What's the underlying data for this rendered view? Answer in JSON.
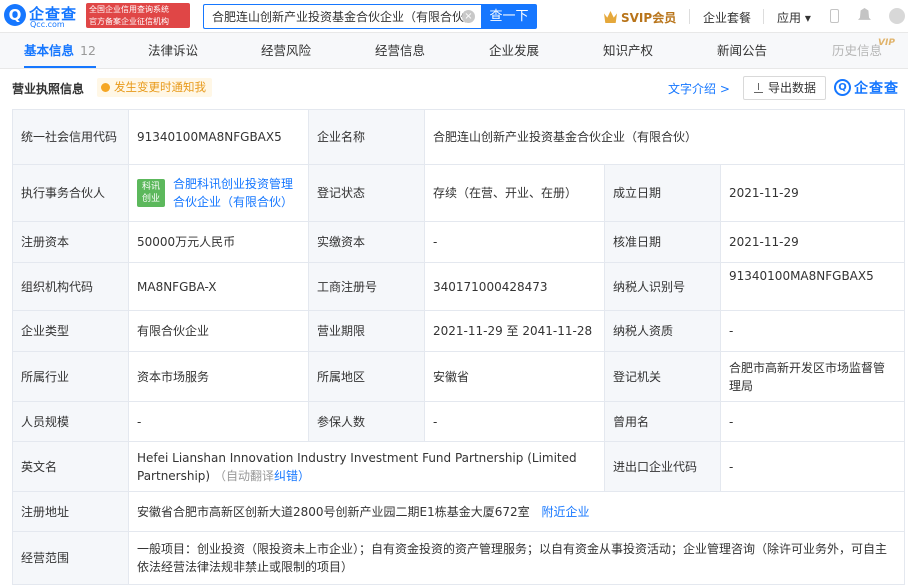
{
  "header": {
    "logo_cn": "企查查",
    "logo_en": "Qcc.com",
    "badge_line1": "全国企业信用查询系统",
    "badge_line2": "官方备案企业征信机构",
    "search_value": "合肥连山创新产业投资基金合伙企业（有限合伙）",
    "search_button": "查一下",
    "svip": "SVIP会员",
    "nav_package": "企业套餐",
    "nav_apps": "应用 ▾"
  },
  "tabs": [
    {
      "label": "基本信息",
      "count": "12"
    },
    {
      "label": "法律诉讼"
    },
    {
      "label": "经营风险"
    },
    {
      "label": "经营信息"
    },
    {
      "label": "企业发展"
    },
    {
      "label": "知识产权"
    },
    {
      "label": "新闻公告"
    },
    {
      "label": "历史信息",
      "tag": "VIP"
    }
  ],
  "section": {
    "title": "营业执照信息",
    "notify": "发生变更时通知我",
    "text_intro": "文字介绍 >",
    "export": "导出数据",
    "watermark": "企查查"
  },
  "table": {
    "credit_code_label": "统一社会信用代码",
    "credit_code": "91340100MA8NFGBAX5",
    "company_name_label": "企业名称",
    "company_name": "合肥连山创新产业投资基金合伙企业（有限合伙）",
    "partner_label": "执行事务合伙人",
    "partner_logo": "科讯 创业",
    "partner_name": "合肥科讯创业投资管理合伙企业（有限合伙）",
    "status_label": "登记状态",
    "status": "存续（在营、开业、在册）",
    "established_label": "成立日期",
    "established": "2021-11-29",
    "reg_capital_label": "注册资本",
    "reg_capital": "50000万元人民币",
    "paid_capital_label": "实缴资本",
    "paid_capital": "-",
    "approval_date_label": "核准日期",
    "approval_date": "2021-11-29",
    "org_code_label": "组织机构代码",
    "org_code": "MA8NFGBA-X",
    "reg_no_label": "工商注册号",
    "reg_no": "340171000428473",
    "taxpayer_id_label": "纳税人识别号",
    "taxpayer_id": "91340100MA8NFGBAX5",
    "company_type_label": "企业类型",
    "company_type": "有限合伙企业",
    "term_label": "营业期限",
    "term": "2021-11-29 至 2041-11-28",
    "taxpayer_qual_label": "纳税人资质",
    "taxpayer_qual": "-",
    "industry_label": "所属行业",
    "industry": "资本市场服务",
    "region_label": "所属地区",
    "region": "安徽省",
    "authority_label": "登记机关",
    "authority": "合肥市高新开发区市场监督管理局",
    "staff_label": "人员规模",
    "staff": "-",
    "insured_label": "参保人数",
    "insured": "-",
    "former_name_label": "曾用名",
    "former_name": "-",
    "english_name_label": "英文名",
    "english_name": "Hefei Lianshan Innovation Industry Investment Fund Partnership (Limited Partnership)",
    "auto_translate": "（自动翻译",
    "correct": "纠错）",
    "ie_code_label": "进出口企业代码",
    "ie_code": "-",
    "address_label": "注册地址",
    "address": "安徽省合肥市高新区创新大道2800号创新产业园二期E1栋基金大厦672室",
    "nearby": "附近企业",
    "scope_label": "经营范围",
    "scope": "一般项目：创业投资（限投资未上市企业）；自有资金投资的资产管理服务；以自有资金从事投资活动；企业管理咨询（除许可业务外，可自主依法经营法律法规非禁止或限制的项目）"
  }
}
